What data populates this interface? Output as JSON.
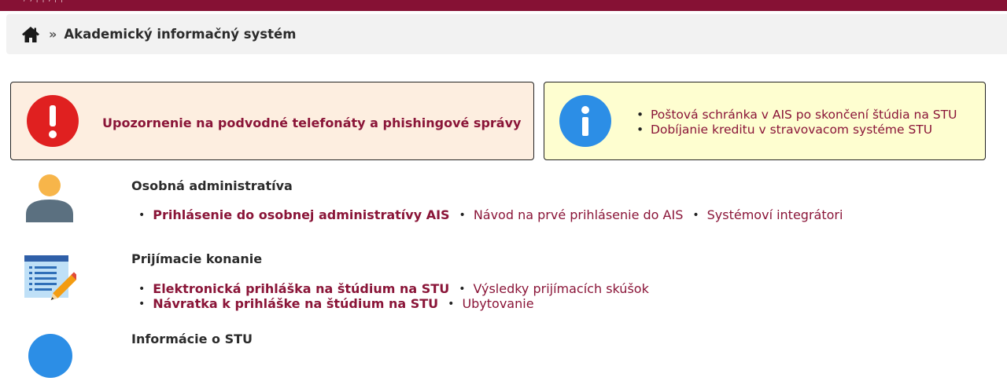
{
  "topbar": {
    "fragment": "/ , | | , | |"
  },
  "breadcrumb": {
    "separator": "»",
    "current": "Akademický informačný systém"
  },
  "alerts": {
    "warning": {
      "link": "Upozornenie na podvodné telefonáty a phishingové správy"
    },
    "info": {
      "links": [
        "Poštová schránka v AIS po skončení štúdia na STU",
        "Dobíjanie kreditu v stravovacom systéme STU"
      ]
    }
  },
  "sections": [
    {
      "title": "Osobná administratíva",
      "rows": [
        [
          {
            "label": "Prihlásenie do osobnej administratívy AIS",
            "bold": true
          },
          {
            "label": "Návod na prvé prihlásenie do AIS",
            "bold": false
          },
          {
            "label": "Systémoví integrátori",
            "bold": false
          }
        ]
      ]
    },
    {
      "title": "Prijímacie konanie",
      "rows": [
        [
          {
            "label": "Elektronická prihláška na štúdium na STU",
            "bold": true
          },
          {
            "label": "Výsledky prijímacích skúšok",
            "bold": false
          }
        ],
        [
          {
            "label": "Návratka k prihláške na štúdium na STU",
            "bold": true
          },
          {
            "label": "Ubytovanie",
            "bold": false
          }
        ]
      ]
    },
    {
      "title": "Informácie o STU",
      "rows": []
    }
  ],
  "colors": {
    "accent": "#861134",
    "link": "#8a1538",
    "warning_bg": "#fdeee0",
    "info_bg": "#fefed0",
    "alert_red": "#e02020",
    "info_blue": "#2c8ee6"
  },
  "icons": [
    "home-icon",
    "exclamation-icon",
    "info-icon",
    "person-icon",
    "notepad-pencil-icon",
    "info-circle-icon"
  ]
}
